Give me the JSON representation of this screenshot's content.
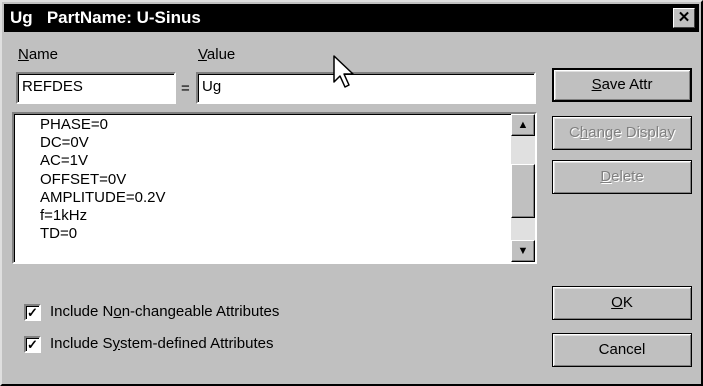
{
  "window": {
    "title": "Ug   PartName: U-Sinus",
    "close_glyph": "✕"
  },
  "labels": {
    "name_access": "N",
    "name_rest": "ame",
    "value_access": "V",
    "value_rest": "alue",
    "equals": "="
  },
  "fields": {
    "name_value": "REFDES",
    "value_value": "Ug"
  },
  "attributes": [
    "PHASE=0",
    "DC=0V",
    "AC=1V",
    "OFFSET=0V",
    "AMPLITUDE=0.2V",
    "f=1kHz",
    "TD=0"
  ],
  "scroll": {
    "up_icon": "▲",
    "down_icon": "▼"
  },
  "buttons": {
    "save_access": "S",
    "save_rest": "ave Attr",
    "change_pre": "C",
    "change_access": "h",
    "change_rest": "ange Display",
    "delete_access": "D",
    "delete_rest": "elete",
    "ok_access": "O",
    "ok_rest": "K",
    "cancel": "Cancel"
  },
  "checkboxes": {
    "nonchangeable_pre": "Include N",
    "nonchangeable_access": "o",
    "nonchangeable_rest": "n-changeable Attributes",
    "nonchangeable_checked": true,
    "system_pre": "Include S",
    "system_access": "y",
    "system_rest": "stem-defined Attributes",
    "system_checked": true,
    "check_glyph": "✓"
  },
  "colors": {
    "titlebar": "#000000",
    "dialog_face": "#c0c0c0",
    "disabled_text": "#808080"
  }
}
